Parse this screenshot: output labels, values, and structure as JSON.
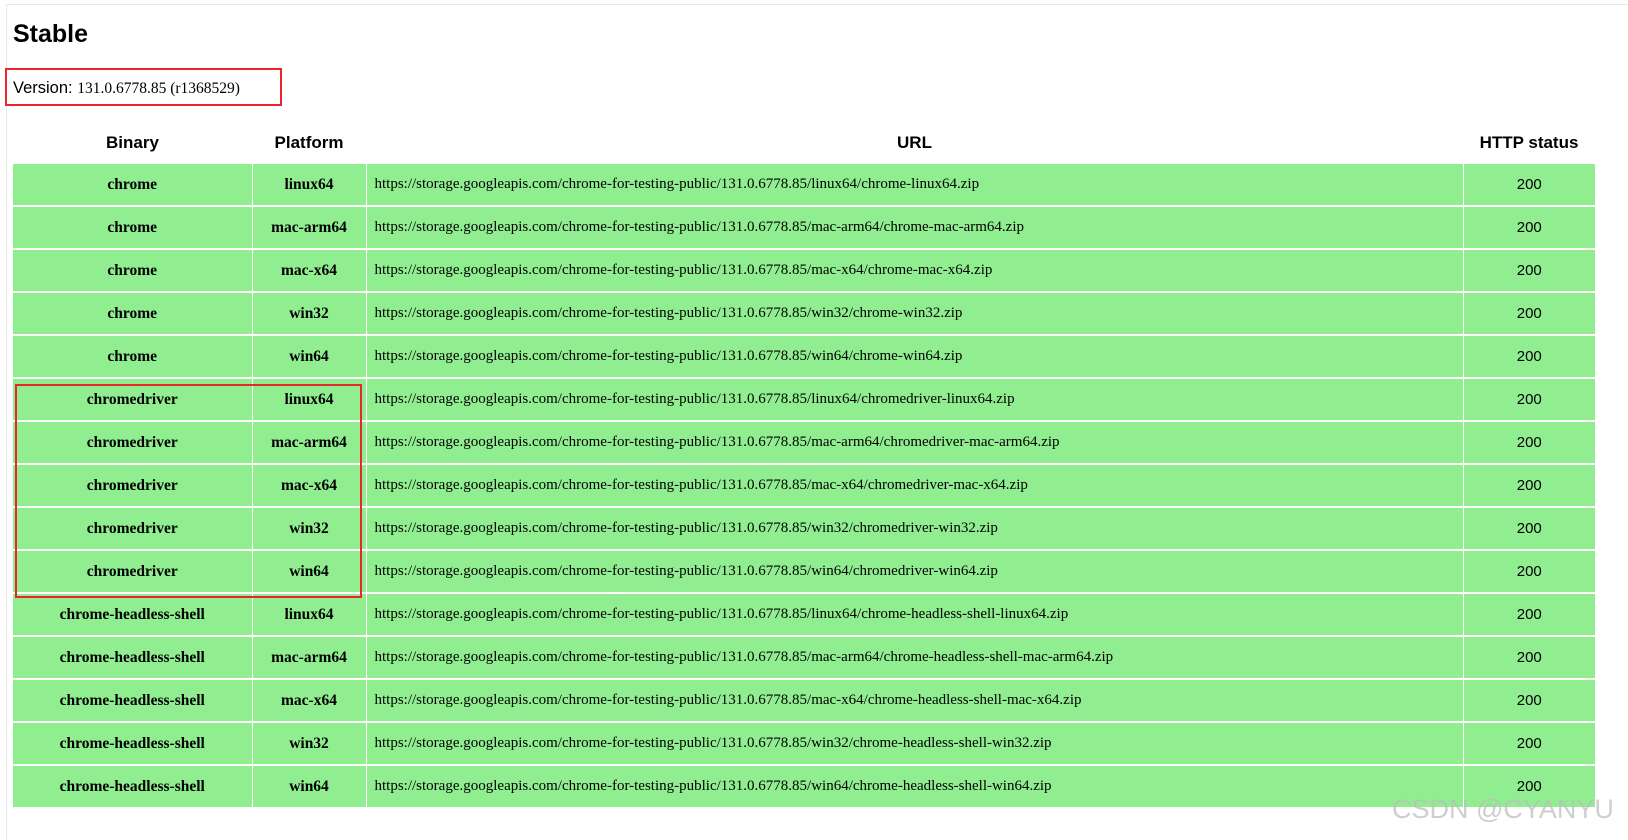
{
  "title": "Stable",
  "version": {
    "label": "Version:",
    "value": "131.0.6778.85 (r1368529)"
  },
  "table": {
    "headers": {
      "binary": "Binary",
      "platform": "Platform",
      "url": "URL",
      "status": "HTTP status"
    },
    "rows": [
      {
        "binary": "chrome",
        "platform": "linux64",
        "url": "https://storage.googleapis.com/chrome-for-testing-public/131.0.6778.85/linux64/chrome-linux64.zip",
        "status": "200"
      },
      {
        "binary": "chrome",
        "platform": "mac-arm64",
        "url": "https://storage.googleapis.com/chrome-for-testing-public/131.0.6778.85/mac-arm64/chrome-mac-arm64.zip",
        "status": "200"
      },
      {
        "binary": "chrome",
        "platform": "mac-x64",
        "url": "https://storage.googleapis.com/chrome-for-testing-public/131.0.6778.85/mac-x64/chrome-mac-x64.zip",
        "status": "200"
      },
      {
        "binary": "chrome",
        "platform": "win32",
        "url": "https://storage.googleapis.com/chrome-for-testing-public/131.0.6778.85/win32/chrome-win32.zip",
        "status": "200"
      },
      {
        "binary": "chrome",
        "platform": "win64",
        "url": "https://storage.googleapis.com/chrome-for-testing-public/131.0.6778.85/win64/chrome-win64.zip",
        "status": "200"
      },
      {
        "binary": "chromedriver",
        "platform": "linux64",
        "url": "https://storage.googleapis.com/chrome-for-testing-public/131.0.6778.85/linux64/chromedriver-linux64.zip",
        "status": "200"
      },
      {
        "binary": "chromedriver",
        "platform": "mac-arm64",
        "url": "https://storage.googleapis.com/chrome-for-testing-public/131.0.6778.85/mac-arm64/chromedriver-mac-arm64.zip",
        "status": "200"
      },
      {
        "binary": "chromedriver",
        "platform": "mac-x64",
        "url": "https://storage.googleapis.com/chrome-for-testing-public/131.0.6778.85/mac-x64/chromedriver-mac-x64.zip",
        "status": "200"
      },
      {
        "binary": "chromedriver",
        "platform": "win32",
        "url": "https://storage.googleapis.com/chrome-for-testing-public/131.0.6778.85/win32/chromedriver-win32.zip",
        "status": "200"
      },
      {
        "binary": "chromedriver",
        "platform": "win64",
        "url": "https://storage.googleapis.com/chrome-for-testing-public/131.0.6778.85/win64/chromedriver-win64.zip",
        "status": "200"
      },
      {
        "binary": "chrome-headless-shell",
        "platform": "linux64",
        "url": "https://storage.googleapis.com/chrome-for-testing-public/131.0.6778.85/linux64/chrome-headless-shell-linux64.zip",
        "status": "200"
      },
      {
        "binary": "chrome-headless-shell",
        "platform": "mac-arm64",
        "url": "https://storage.googleapis.com/chrome-for-testing-public/131.0.6778.85/mac-arm64/chrome-headless-shell-mac-arm64.zip",
        "status": "200"
      },
      {
        "binary": "chrome-headless-shell",
        "platform": "mac-x64",
        "url": "https://storage.googleapis.com/chrome-for-testing-public/131.0.6778.85/mac-x64/chrome-headless-shell-mac-x64.zip",
        "status": "200"
      },
      {
        "binary": "chrome-headless-shell",
        "platform": "win32",
        "url": "https://storage.googleapis.com/chrome-for-testing-public/131.0.6778.85/win32/chrome-headless-shell-win32.zip",
        "status": "200"
      },
      {
        "binary": "chrome-headless-shell",
        "platform": "win64",
        "url": "https://storage.googleapis.com/chrome-for-testing-public/131.0.6778.85/win64/chrome-headless-shell-win64.zip",
        "status": "200"
      }
    ]
  },
  "watermark": "CSDN @CYANYU",
  "colors": {
    "row_background": "#90ee90",
    "highlight_border": "#e8262c"
  }
}
